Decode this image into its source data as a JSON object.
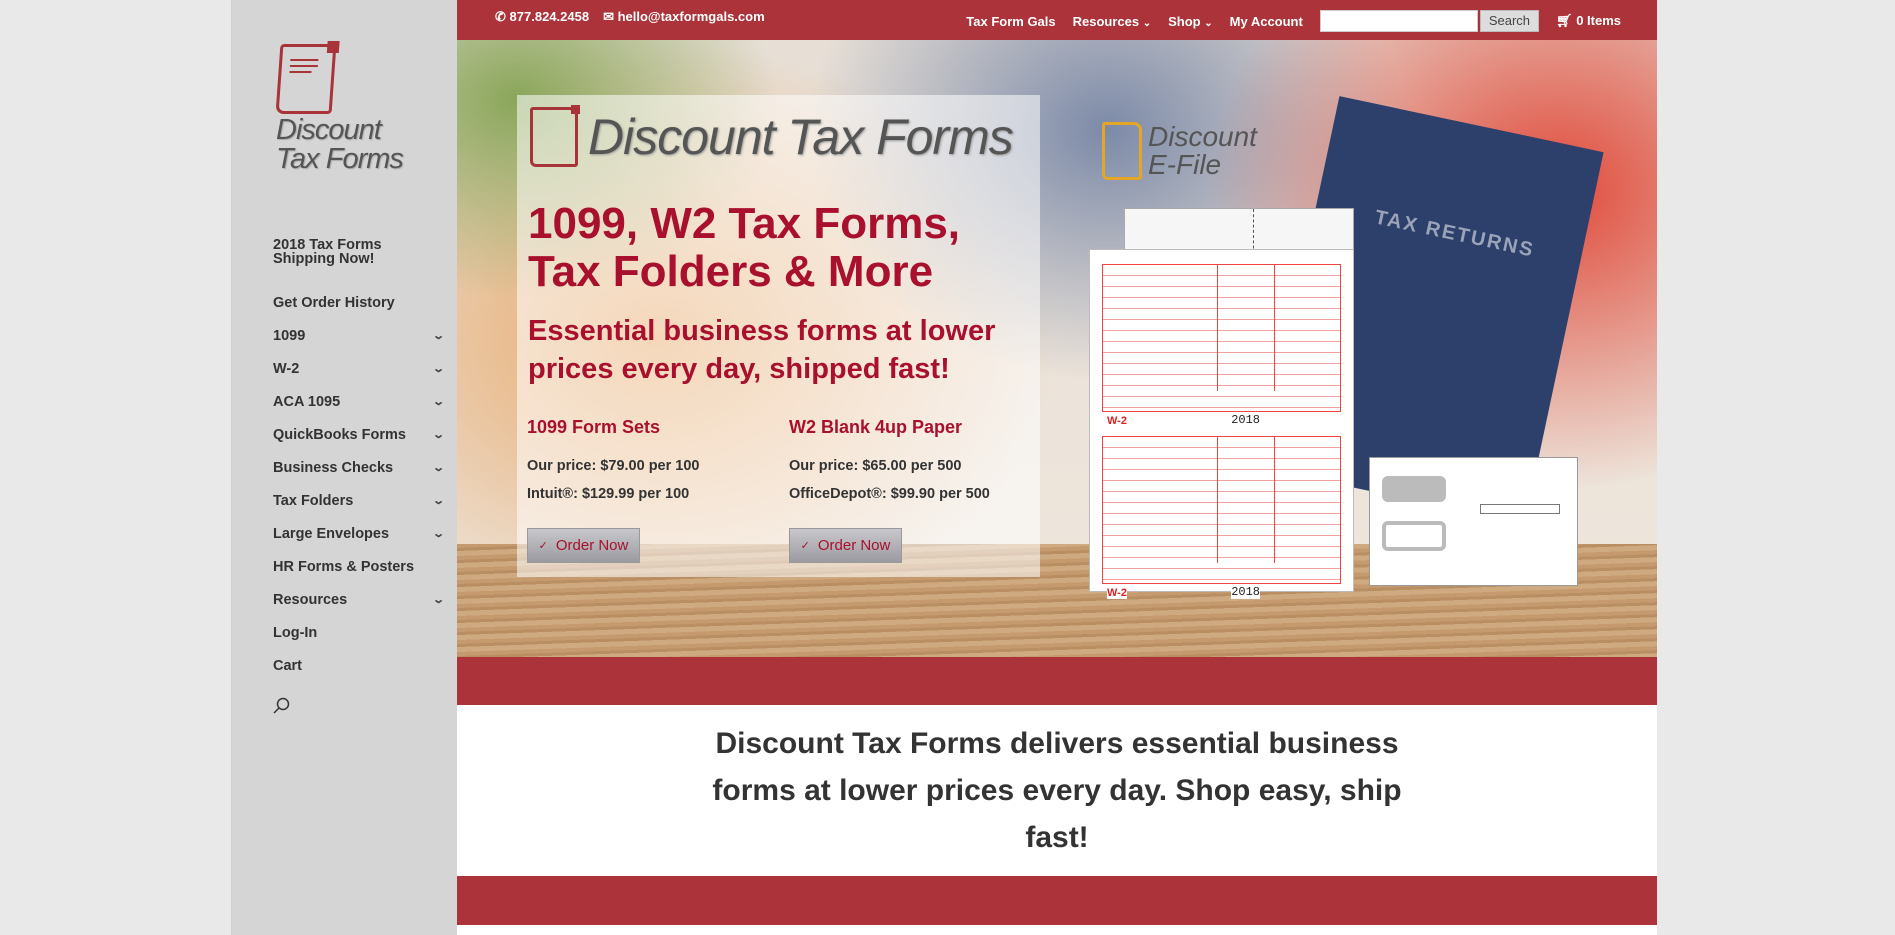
{
  "topbar": {
    "phone": "877.824.2458",
    "email": "hello@taxformgals.com",
    "nav": [
      "Tax Form Gals",
      "Resources",
      "Shop",
      "My Account"
    ],
    "search_button": "Search",
    "search_placeholder": "",
    "cart": "0 Items"
  },
  "sidebar": {
    "logo_text": "Discount Tax Forms",
    "items": [
      {
        "label": "2018 Tax Forms Shipping Now!",
        "has_children": false
      },
      {
        "label": "Get Order History",
        "has_children": false
      },
      {
        "label": "1099",
        "has_children": true
      },
      {
        "label": "W-2",
        "has_children": true
      },
      {
        "label": "ACA 1095",
        "has_children": true
      },
      {
        "label": "QuickBooks Forms",
        "has_children": true
      },
      {
        "label": "Business Checks",
        "has_children": true
      },
      {
        "label": "Tax Folders",
        "has_children": true
      },
      {
        "label": "Large Envelopes",
        "has_children": true
      },
      {
        "label": "HR Forms & Posters",
        "has_children": false
      },
      {
        "label": "Resources",
        "has_children": true
      },
      {
        "label": "Log-In",
        "has_children": false
      },
      {
        "label": "Cart",
        "has_children": false
      }
    ]
  },
  "hero": {
    "brand": "Discount Tax Forms",
    "headline": "1099, W2 Tax Forms, Tax Folders & More",
    "subheadline": "Essential business forms at lower prices every day, shipped fast!",
    "products": [
      {
        "title": "1099 Form Sets",
        "our_price": "Our price: $79.00 per 100",
        "compare": "Intuit®: $129.99 per 100",
        "button": "Order Now"
      },
      {
        "title": "W2 Blank 4up Paper",
        "our_price": "Our price: $65.00 per 500",
        "compare": "OfficeDepot®: $99.90 per 500",
        "button": "Order Now"
      }
    ],
    "efile_logo": "Discount E-File",
    "folder_text": "TAX RETURNS",
    "form_label": "W-2",
    "form_year": "2018"
  },
  "tagline": "Discount Tax Forms delivers essential business forms at lower prices every day. Shop easy, ship fast!",
  "colors": {
    "brand_red": "#ab3339",
    "headline_red": "#a8102e",
    "sidebar_bg": "#d5d5d5"
  }
}
